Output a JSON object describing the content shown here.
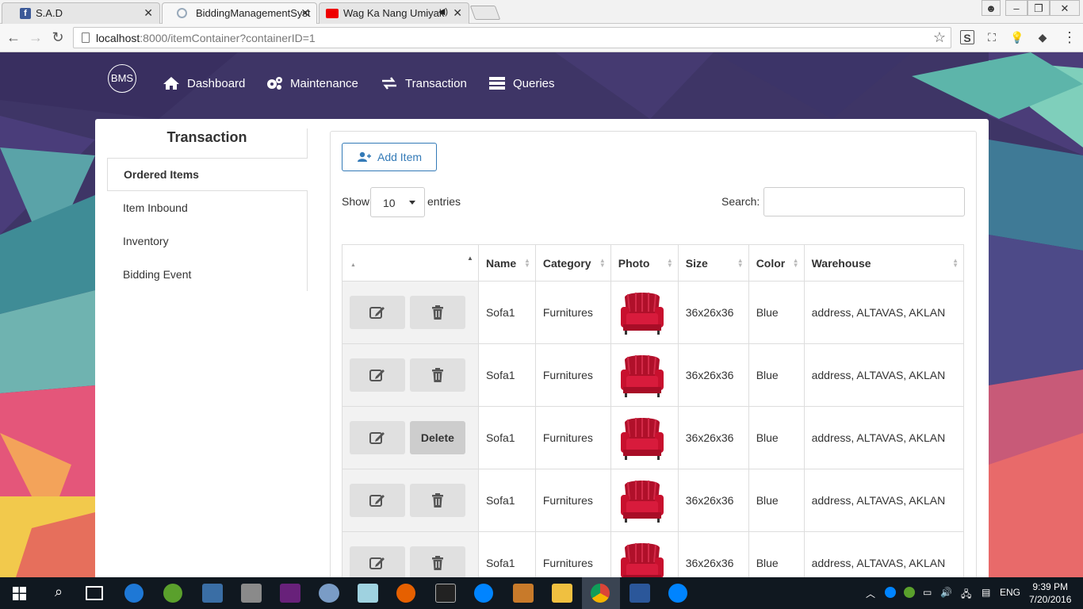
{
  "browser": {
    "tabs": [
      {
        "title": "S.A.D",
        "favicon": "facebook-icon"
      },
      {
        "title": "BiddingManagementSyst",
        "favicon": "loading-icon",
        "active": true
      },
      {
        "title": "Wag Ka Nang Umiyak",
        "favicon": "youtube-icon",
        "audio": true
      }
    ],
    "url_host": "localhost",
    "url_rest": ":8000/itemContainer?containerID=1"
  },
  "nav": {
    "logo": "BMS",
    "items": [
      {
        "label": "Dashboard",
        "icon": "home-icon"
      },
      {
        "label": "Maintenance",
        "icon": "gears-icon"
      },
      {
        "label": "Transaction",
        "icon": "exchange-icon"
      },
      {
        "label": "Queries",
        "icon": "list-icon"
      }
    ]
  },
  "sidebar": {
    "title": "Transaction",
    "items": [
      {
        "label": "Ordered Items",
        "active": true
      },
      {
        "label": "Item Inbound"
      },
      {
        "label": "Inventory"
      },
      {
        "label": "Bidding Event"
      }
    ]
  },
  "main": {
    "add_button": "Add Item",
    "show_label": "Show",
    "entries_value": "10",
    "entries_label": "entries",
    "search_label": "Search:",
    "search_value": "",
    "columns": [
      "",
      "Name",
      "Category",
      "Photo",
      "Size",
      "Color",
      "Warehouse"
    ],
    "rows": [
      {
        "name": "Sofa1",
        "category": "Furnitures",
        "size": "36x26x36",
        "color": "Blue",
        "warehouse": "address, ALTAVAS, AKLAN",
        "delete_label": ""
      },
      {
        "name": "Sofa1",
        "category": "Furnitures",
        "size": "36x26x36",
        "color": "Blue",
        "warehouse": "address, ALTAVAS, AKLAN",
        "delete_label": ""
      },
      {
        "name": "Sofa1",
        "category": "Furnitures",
        "size": "36x26x36",
        "color": "Blue",
        "warehouse": "address, ALTAVAS, AKLAN",
        "delete_label": "Delete"
      },
      {
        "name": "Sofa1",
        "category": "Furnitures",
        "size": "36x26x36",
        "color": "Blue",
        "warehouse": "address, ALTAVAS, AKLAN",
        "delete_label": ""
      },
      {
        "name": "Sofa1",
        "category": "Furnitures",
        "size": "36x26x36",
        "color": "Blue",
        "warehouse": "address, ALTAVAS, AKLAN",
        "delete_label": ""
      }
    ]
  },
  "taskbar": {
    "language": "ENG",
    "time": "9:39 PM",
    "date": "7/20/2016"
  },
  "colors": {
    "accent": "#337ab7",
    "navbar_bg": "#3b2e5e",
    "taskbar": "#101820",
    "chair": "#c8102e"
  }
}
